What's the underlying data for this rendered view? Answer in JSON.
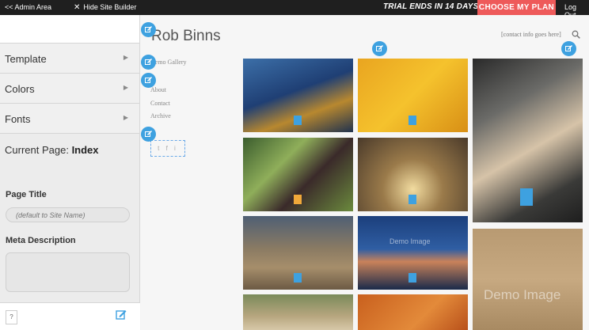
{
  "topbar": {
    "admin_label": "<< Admin Area",
    "hide_label": "Hide Site Builder",
    "trial_text": "TRIAL ENDS IN 14 DAYS",
    "plan_button": "CHOOSE MY PLAN",
    "logout_label": "Log Out"
  },
  "sidebar": {
    "items": [
      {
        "label": "Template"
      },
      {
        "label": "Colors"
      },
      {
        "label": "Fonts"
      }
    ],
    "current_page_label": "Current Page:",
    "current_page_value": "Index",
    "page_title_label": "Page Title",
    "page_title_placeholder": "(default to Site Name)",
    "meta_description_label": "Meta Description",
    "help_label": "?"
  },
  "site": {
    "title": "Rob Binns",
    "contact_placeholder": "[contact info goes here]",
    "nav": [
      "Demo Gallery",
      "About",
      "Contact",
      "Archive"
    ],
    "social": "t f i",
    "demo_text": "Demo Image"
  },
  "colors": {
    "accent": "#3ea1e0",
    "plan_button": "#ee5a5a",
    "topbar": "#1f1f1f"
  }
}
